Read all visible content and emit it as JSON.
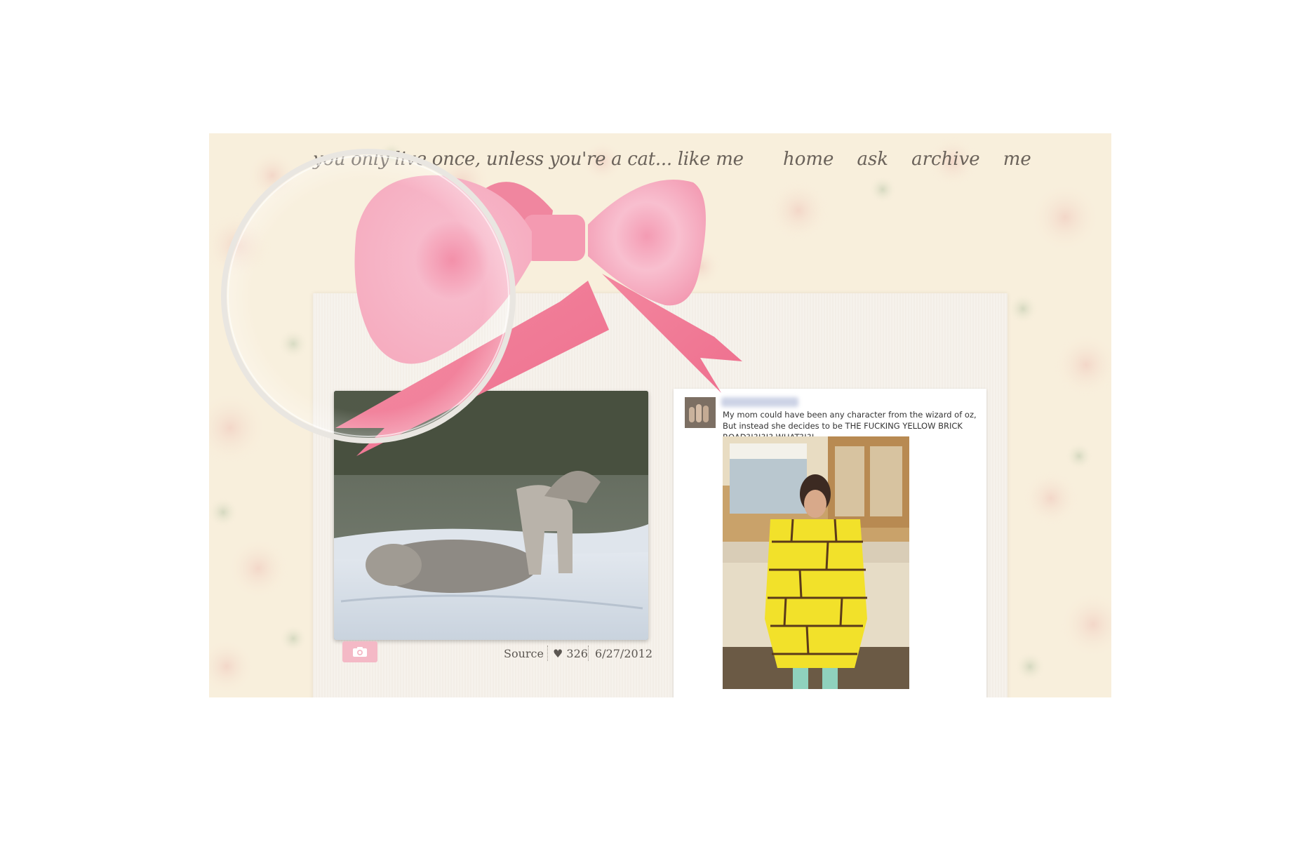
{
  "blog": {
    "title": "you only live once, unless you're a cat... like me"
  },
  "nav": {
    "items": [
      {
        "label": "home"
      },
      {
        "label": "ask"
      },
      {
        "label": "archive"
      },
      {
        "label": "me"
      }
    ]
  },
  "posts": [
    {
      "type": "photo",
      "icon": "camera-icon",
      "source_label": "Source",
      "notes": "♥ 326",
      "date": "6/27/2012"
    },
    {
      "type": "photo",
      "caption": "My mom could have been any character from the wizard of oz, But instead she decides to be THE FUCKING YELLOW BRICK ROAD?!?!?!? WHAT?!?!"
    }
  ],
  "colors": {
    "background": "#f8efdc",
    "accent_pink": "#f4a6b8",
    "text": "#6a625a"
  }
}
